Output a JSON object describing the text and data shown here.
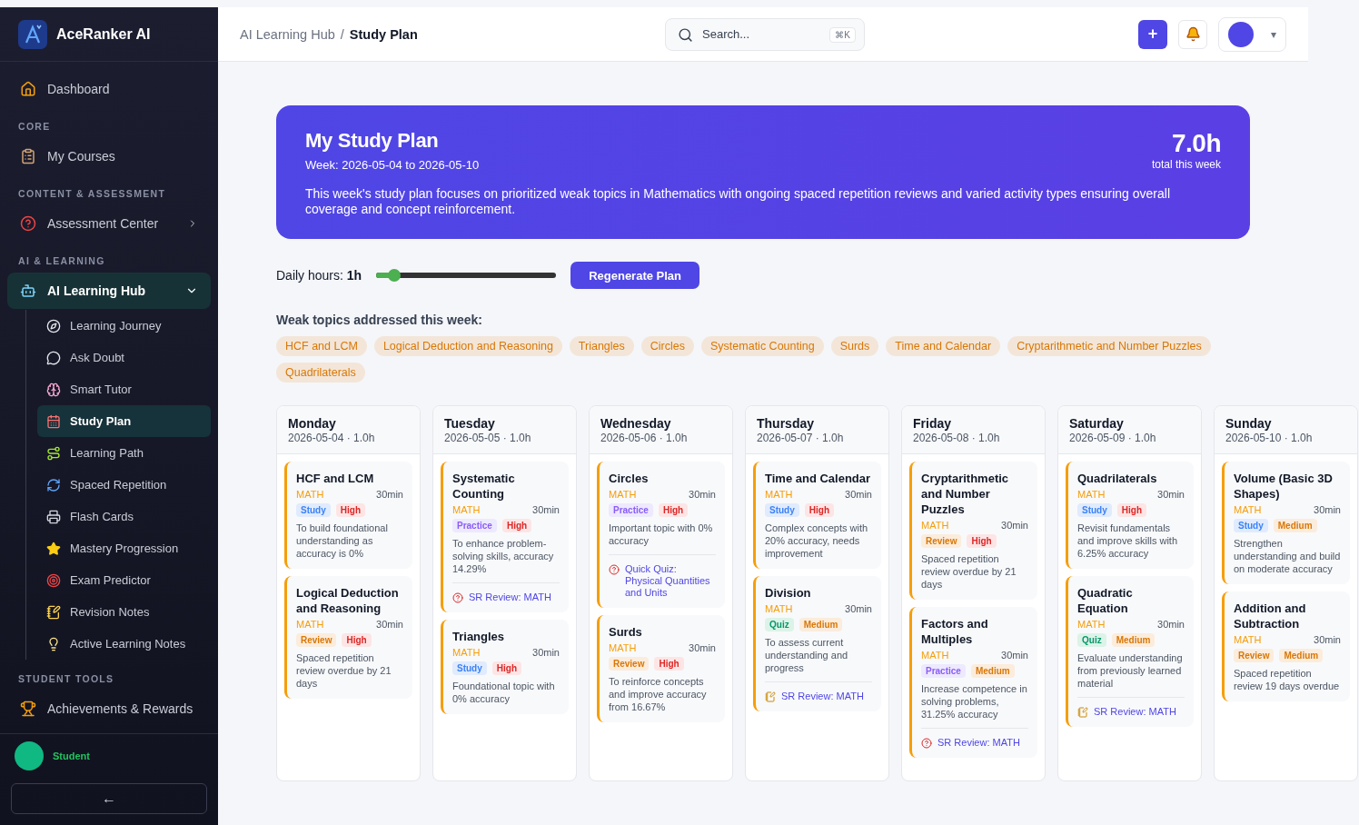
{
  "sidebar": {
    "brand": "AceRanker AI",
    "sections": [
      {
        "items": [
          {
            "label": "Dashboard",
            "kind": "home",
            "selected": false
          }
        ]
      },
      {
        "heading": "CORE",
        "items": [
          {
            "label": "My Courses",
            "kind": "clipboard",
            "selected": false
          }
        ]
      },
      {
        "heading": "CONTENT & ASSESSMENT",
        "items": [
          {
            "label": "Assessment Center",
            "kind": "question",
            "selected": false,
            "expanded": false
          }
        ]
      },
      {
        "heading": "AI & LEARNING",
        "items": [
          {
            "label": "AI Learning Hub",
            "kind": "bot",
            "selected": false,
            "expanded": true,
            "children": [
              {
                "label": "Learning Journey",
                "kind": "compass",
                "selected": false
              },
              {
                "label": "Ask Doubt",
                "kind": "chat",
                "selected": false
              },
              {
                "label": "Smart Tutor",
                "kind": "brain",
                "selected": false
              },
              {
                "label": "Study Plan",
                "kind": "calendar",
                "selected": true
              },
              {
                "label": "Learning Path",
                "kind": "route",
                "selected": false
              },
              {
                "label": "Spaced Repetition",
                "kind": "repeat",
                "selected": false
              },
              {
                "label": "Flash Cards",
                "kind": "printer",
                "selected": false
              },
              {
                "label": "Mastery Progression",
                "kind": "star",
                "selected": false
              },
              {
                "label": "Exam Predictor",
                "kind": "target",
                "selected": false
              },
              {
                "label": "Revision Notes",
                "kind": "note",
                "selected": false
              },
              {
                "label": "Active Learning Notes",
                "kind": "bulb",
                "selected": false
              }
            ]
          }
        ]
      },
      {
        "heading": "STUDENT TOOLS",
        "items": [
          {
            "label": "Achievements & Rewards",
            "kind": "trophy",
            "selected": false
          }
        ]
      }
    ],
    "user": {
      "name": "Student"
    },
    "collapse_button": "←"
  },
  "topbar": {
    "breadcrumbs": [
      "AI Learning Hub",
      "Study Plan"
    ],
    "separator": "/",
    "search": {
      "placeholder": "Search...",
      "shortcut": "⌘K"
    },
    "add_button": "+",
    "profile_caret": "▾"
  },
  "banner": {
    "title": "My Study Plan",
    "week": "Week: 2026-05-04 to 2026-05-10",
    "total": "7.0h",
    "total_label": "total this week",
    "description": "This week's study plan focuses on prioritized weak topics in Mathematics with ongoing spaced repetition reviews and varied activity types ensuring overall coverage and concept reinforcement."
  },
  "controls": {
    "label": "Daily hours: **1h**",
    "level": 0.1,
    "button": "Regenerate Plan"
  },
  "weak_topics": {
    "heading": "Weak topics addressed this week:",
    "topics": [
      "HCF and LCM",
      "Logical Deduction and Reasoning",
      "Triangles",
      "Circles",
      "Systematic Counting",
      "Surds",
      "Time and Calendar",
      "Cryptarithmetic and Number Puzzles",
      "Quadrilaterals"
    ]
  },
  "days": [
    {
      "day": "Monday",
      "meta": "2026-05-04 · 1.0h",
      "tasks": [
        {
          "title": "HCF and LCM",
          "subject": "MATH",
          "duration": "30min",
          "tags": [
            {
              "label": "Study",
              "kind": "study"
            },
            {
              "label": "High",
              "kind": "high"
            }
          ],
          "note": "To build foundational understanding as accuracy is 0%"
        },
        {
          "title": "Logical Deduction and Reasoning",
          "subject": "MATH",
          "duration": "30min",
          "tags": [
            {
              "label": "Review",
              "kind": "review"
            },
            {
              "label": "High",
              "kind": "high"
            }
          ],
          "note": "Spaced repetition review overdue by 21 days"
        }
      ]
    },
    {
      "day": "Tuesday",
      "meta": "2026-05-05 · 1.0h",
      "tasks": [
        {
          "title": "Systematic Counting",
          "subject": "MATH",
          "duration": "30min",
          "tags": [
            {
              "label": "Practice",
              "kind": "practice"
            },
            {
              "label": "High",
              "kind": "high"
            }
          ],
          "note": "To enhance problem-solving skills, accuracy 14.29%",
          "link": {
            "kind": "quiz",
            "text": "SR Review: MATH"
          }
        },
        {
          "title": "Triangles",
          "subject": "MATH",
          "duration": "30min",
          "tags": [
            {
              "label": "Study",
              "kind": "study"
            },
            {
              "label": "High",
              "kind": "high"
            }
          ],
          "note": "Foundational topic with 0% accuracy"
        }
      ]
    },
    {
      "day": "Wednesday",
      "meta": "2026-05-06 · 1.0h",
      "tasks": [
        {
          "title": "Circles",
          "subject": "MATH",
          "duration": "30min",
          "tags": [
            {
              "label": "Practice",
              "kind": "practice"
            },
            {
              "label": "High",
              "kind": "high"
            }
          ],
          "note": "Important topic with 0% accuracy",
          "link": {
            "kind": "quiz",
            "text": "Quick Quiz: Physical Quantities and Units"
          }
        },
        {
          "title": "Surds",
          "subject": "MATH",
          "duration": "30min",
          "tags": [
            {
              "label": "Review",
              "kind": "review"
            },
            {
              "label": "High",
              "kind": "high"
            }
          ],
          "note": "To reinforce concepts and improve accuracy from 16.67%"
        }
      ]
    },
    {
      "day": "Thursday",
      "meta": "2026-05-07 · 1.0h",
      "tasks": [
        {
          "title": "Time and Calendar",
          "subject": "MATH",
          "duration": "30min",
          "tags": [
            {
              "label": "Study",
              "kind": "study"
            },
            {
              "label": "High",
              "kind": "high"
            }
          ],
          "note": "Complex concepts with 20% accuracy, needs improvement"
        },
        {
          "title": "Division",
          "subject": "MATH",
          "duration": "30min",
          "tags": [
            {
              "label": "Quiz",
              "kind": "quiz"
            },
            {
              "label": "Medium",
              "kind": "medium"
            }
          ],
          "note": "To assess current understanding and progress",
          "link": {
            "kind": "note",
            "text": "SR Review: MATH"
          }
        }
      ]
    },
    {
      "day": "Friday",
      "meta": "2026-05-08 · 1.0h",
      "tasks": [
        {
          "title": "Cryptarithmetic and Number Puzzles",
          "subject": "MATH",
          "duration": "30min",
          "tags": [
            {
              "label": "Review",
              "kind": "review"
            },
            {
              "label": "High",
              "kind": "high"
            }
          ],
          "note": "Spaced repetition review overdue by 21 days"
        },
        {
          "title": "Factors and Multiples",
          "subject": "MATH",
          "duration": "30min",
          "tags": [
            {
              "label": "Practice",
              "kind": "practice"
            },
            {
              "label": "Medium",
              "kind": "medium"
            }
          ],
          "note": "Increase competence in solving problems, 31.25% accuracy",
          "link": {
            "kind": "quiz",
            "text": "SR Review: MATH"
          }
        }
      ]
    },
    {
      "day": "Saturday",
      "meta": "2026-05-09 · 1.0h",
      "tasks": [
        {
          "title": "Quadrilaterals",
          "subject": "MATH",
          "duration": "30min",
          "tags": [
            {
              "label": "Study",
              "kind": "study"
            },
            {
              "label": "High",
              "kind": "high"
            }
          ],
          "note": "Revisit fundamentals and improve skills with 6.25% accuracy"
        },
        {
          "title": "Quadratic Equation",
          "subject": "MATH",
          "duration": "30min",
          "tags": [
            {
              "label": "Quiz",
              "kind": "quiz"
            },
            {
              "label": "Medium",
              "kind": "medium"
            }
          ],
          "note": "Evaluate understanding from previously learned material",
          "link": {
            "kind": "note",
            "text": "SR Review: MATH"
          }
        }
      ]
    },
    {
      "day": "Sunday",
      "meta": "2026-05-10 · 1.0h",
      "tasks": [
        {
          "title": "Volume (Basic 3D Shapes)",
          "subject": "MATH",
          "duration": "30min",
          "tags": [
            {
              "label": "Study",
              "kind": "study"
            },
            {
              "label": "Medium",
              "kind": "medium"
            }
          ],
          "note": "Strengthen understanding and build on moderate accuracy"
        },
        {
          "title": "Addition and Subtraction",
          "subject": "MATH",
          "duration": "30min",
          "tags": [
            {
              "label": "Review",
              "kind": "review"
            },
            {
              "label": "Medium",
              "kind": "medium"
            }
          ],
          "note": "Spaced repetition review 19 days overdue"
        }
      ]
    }
  ]
}
